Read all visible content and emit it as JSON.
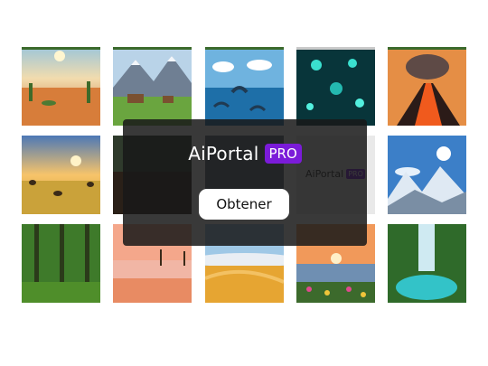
{
  "brand": {
    "name": "AiPortal",
    "badge": "PRO",
    "badge_color": "#7b1bd9"
  },
  "cta": {
    "label": "Obtener"
  },
  "gallery": {
    "tiles": [
      {
        "row": 0,
        "col": 0,
        "subject": "desert with cacti"
      },
      {
        "row": 0,
        "col": 1,
        "subject": "mountain meadow with deer"
      },
      {
        "row": 0,
        "col": 2,
        "subject": "dolphins jumping in ocean"
      },
      {
        "row": 0,
        "col": 3,
        "subject": "glowing underwater cave"
      },
      {
        "row": 0,
        "col": 4,
        "subject": "erupting volcano"
      },
      {
        "row": 1,
        "col": 0,
        "subject": "savanna sunset with animals"
      },
      {
        "row": 1,
        "col": 1,
        "subject": "dark forest lake"
      },
      {
        "row": 1,
        "col": 2,
        "subject": "sky"
      },
      {
        "row": 1,
        "col": 3,
        "subject": "logo tile"
      },
      {
        "row": 1,
        "col": 4,
        "subject": "snowy mountains with sun"
      },
      {
        "row": 2,
        "col": 0,
        "subject": "green forest"
      },
      {
        "row": 2,
        "col": 1,
        "subject": "tropical beach at sunset"
      },
      {
        "row": 2,
        "col": 2,
        "subject": "sand dunes"
      },
      {
        "row": 2,
        "col": 3,
        "subject": "flowers at lake sunset"
      },
      {
        "row": 2,
        "col": 4,
        "subject": "jungle waterfall"
      }
    ]
  }
}
